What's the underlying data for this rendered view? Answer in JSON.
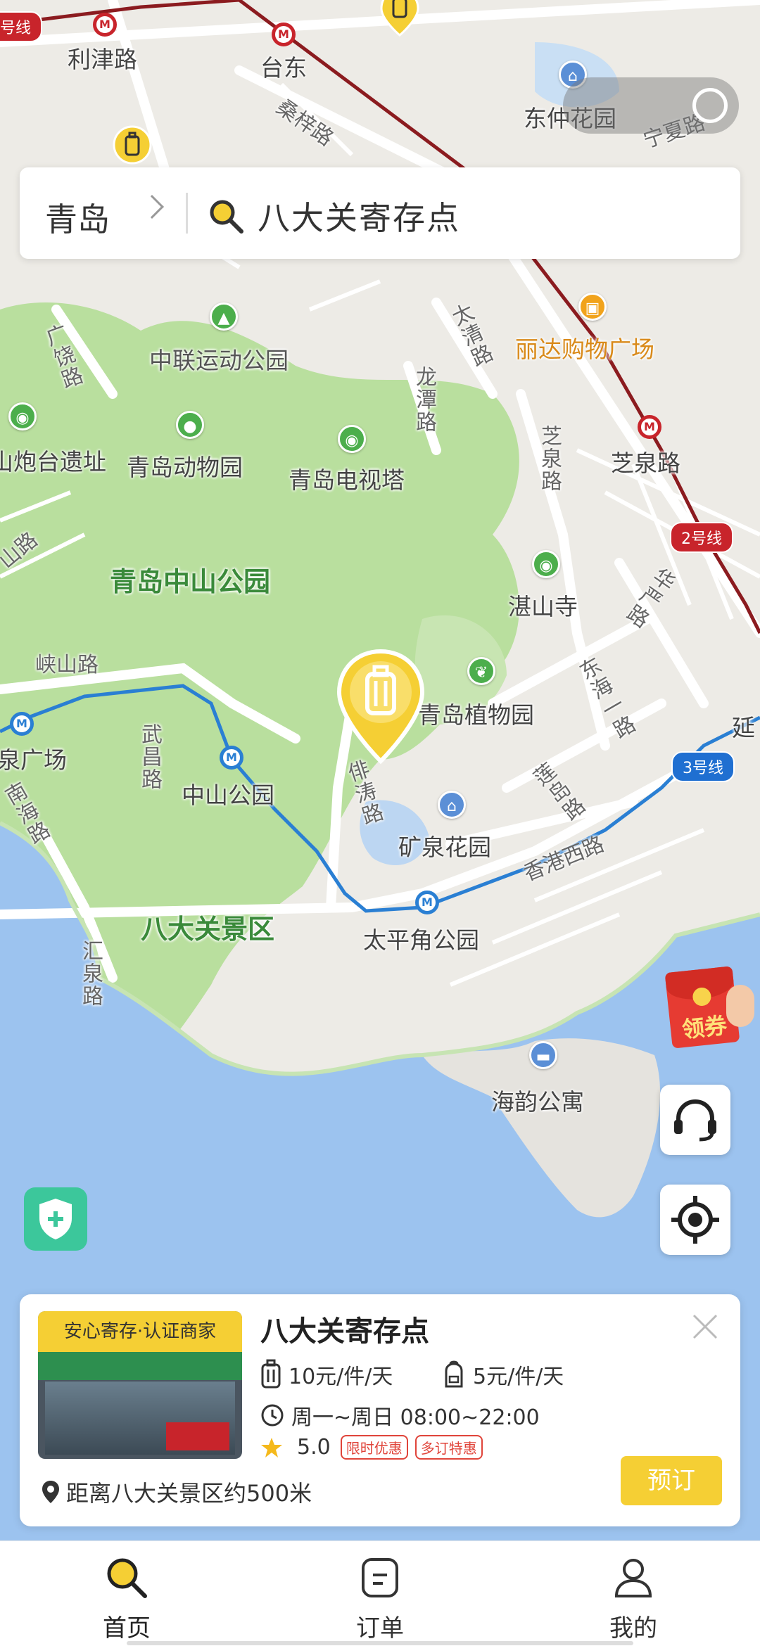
{
  "status_bar": {
    "time": "",
    "icons": ""
  },
  "map": {
    "labels": {
      "line2_top": "号线",
      "lijin_road": "利津路",
      "taidong": "台东",
      "sangzi_road": "桑梓路",
      "dongzhong_garden": "东仲花园",
      "ningxia_road": "宁夏路",
      "guangrao_road": "广饶路",
      "zhonglian_park": "中联运动公园",
      "taiqing_road": "太清路",
      "lida_mall": "丽达购物广场",
      "longtan_road": "龙潭路",
      "paotai_ruins": "山炮台遗址",
      "qingdao_zoo": "青岛动物园",
      "tv_tower": "青岛电视塔",
      "zhiquan_road_v": "芝泉路",
      "zhiquan_road": "芝泉路",
      "shan_road": "山路",
      "zhongshan_park_area": "青岛中山公园",
      "zhanshan_temple": "湛山寺",
      "hua_road": "华严路",
      "xiashan_road": "峡山路",
      "botanical_garden": "青岛植物园",
      "donghai_road": "东海一路",
      "quan_square": "泉广场",
      "wuchang_road": "武昌路",
      "zhongshan_park_station": "中山公园",
      "yutao_road": "俳涛路",
      "lian_dao_road": "莲岛路",
      "yan": "延",
      "nanhai_road": "南海路",
      "kuangquan_garden": "矿泉花园",
      "xianggang_w_road": "香港西路",
      "badaguan": "八大关景区",
      "taipingjiao_park": "太平角公园",
      "huiquan_road": "汇泉路",
      "haiyun_apartment": "海韵公寓"
    },
    "line2_badge": "2号线",
    "line3_badge": "3号线",
    "line2_top_badge": "号线"
  },
  "search": {
    "city": "青岛",
    "query": "八大关寄存点"
  },
  "coupon": {
    "label": "领券"
  },
  "card": {
    "badge": "安心寄存·认证商家",
    "title": "八大关寄存点",
    "price_luggage": "10元/件/天",
    "price_bag": "5元/件/天",
    "hours": "周一~周日 08:00~22:00",
    "rating": "5.0",
    "tag1": "限时优惠",
    "tag2": "多订特惠",
    "distance": "距离八大关景区约500米",
    "book": "预订"
  },
  "nav": {
    "items": [
      {
        "label": "首页",
        "icon": "search-icon",
        "active": true
      },
      {
        "label": "订单",
        "icon": "order-icon",
        "active": false
      },
      {
        "label": "我的",
        "icon": "profile-icon",
        "active": false
      }
    ]
  },
  "colors": {
    "accent": "#f5cf34",
    "park": "#b9df9e",
    "water": "#9cc3ef",
    "metro_red": "#c8242b",
    "metro_blue": "#2a7fd3"
  }
}
